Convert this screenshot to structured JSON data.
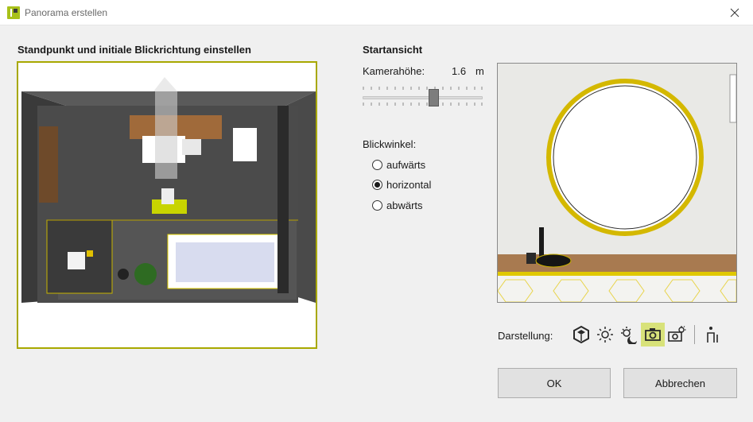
{
  "window": {
    "title": "Panorama erstellen"
  },
  "plan": {
    "heading": "Standpunkt und initiale Blickrichtung einstellen"
  },
  "start_view": {
    "heading": "Startansicht",
    "camera_height_label": "Kamerahöhe:",
    "camera_height_value": "1.6",
    "camera_height_unit": "m",
    "view_angle_label": "Blickwinkel:",
    "options": [
      {
        "label": "aufwärts",
        "checked": false
      },
      {
        "label": "horizontal",
        "checked": true
      },
      {
        "label": "abwärts",
        "checked": false
      }
    ]
  },
  "display": {
    "label": "Darstellung:",
    "icons": [
      "cube-icon",
      "sun-icon",
      "sun-moon-icon",
      "camera-icon",
      "camera-settings-icon",
      "person-icon"
    ],
    "active_icon": "camera-icon"
  },
  "buttons": {
    "ok": "OK",
    "cancel": "Abbrechen"
  },
  "colors": {
    "accent": "#a8c11a",
    "frame": "#a8a800",
    "active": "#d8e27a"
  }
}
